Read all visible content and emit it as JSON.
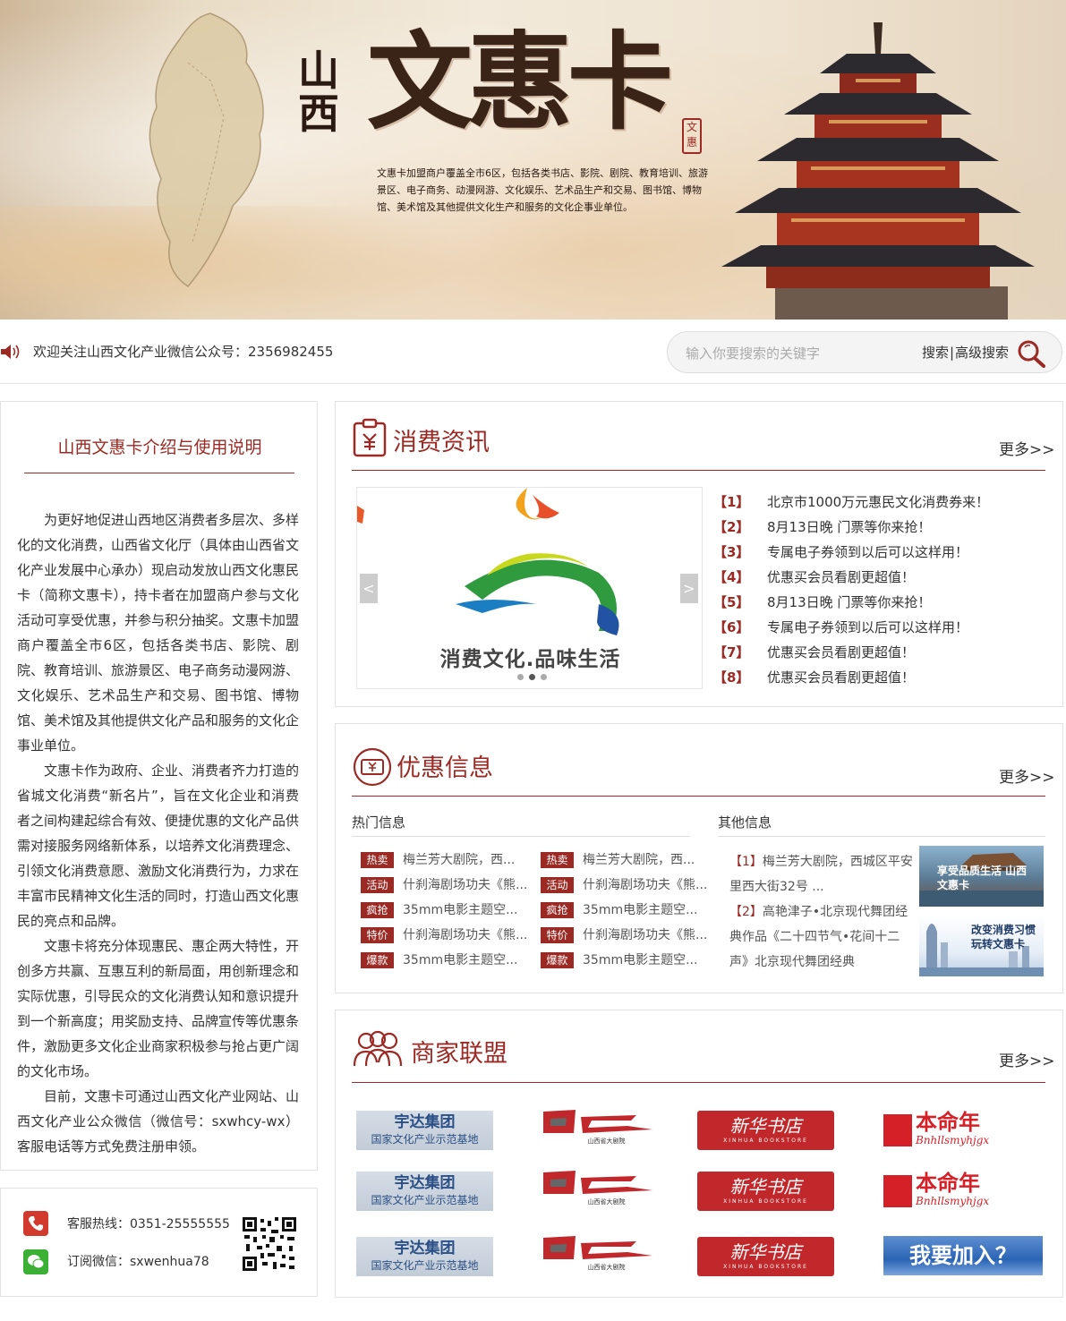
{
  "banner": {
    "logo_small": "山西",
    "logo_big": "文惠卡",
    "seal": "文惠",
    "description": "文惠卡加盟商户覆盖全市6区，包括各类书店、影院、剧院、教育培训、旅游景区、电子商务、动漫网游、文化娱乐、艺术品生产和交易、图书馆、博物馆、美术馆及其他提供文化生产和服务的文化企事业单位。"
  },
  "notice": {
    "text": "欢迎关注山西文化产业微信公众号：2356982455"
  },
  "search": {
    "placeholder": "输入你要搜索的关键字",
    "value": "",
    "search_label": "搜索",
    "separator": "|",
    "advanced_label": "高级搜索"
  },
  "intro": {
    "title": "山西文惠卡介绍与使用说明",
    "paragraphs": [
      "为更好地促进山西地区消费者多层次、多样化的文化消费，山西省文化厅（具体由山西省文化产业发展中心承办）现启动发放山西文化惠民卡（简称文惠卡），持卡者在加盟商户参与文化活动可享受优惠，并参与积分抽奖。文惠卡加盟商户覆盖全市6区，包括各类书店、影院、剧院、教育培训、旅游景区、电子商务动漫网游、文化娱乐、艺术品生产和交易、图书馆、博物馆、美术馆及其他提供文化产品和服务的文化企事业单位。",
      "文惠卡作为政府、企业、消费者齐力打造的省城文化消费“新名片”，旨在文化企业和消费者之间构建起综合有效、便捷优惠的文化产品供需对接服务网络新体系，以培养文化消费理念、引领文化消费意愿、激励文化消费行为，力求在丰富市民精神文化生活的同时，打造山西文化惠民的亮点和品牌。",
      "文惠卡将充分体现惠民、惠企两大特性，开创多方共赢、互惠互利的新局面，用创新理念和实际优惠，引导民众的文化消费认知和意识提升到一个新高度；用奖励支持、品牌宣传等优惠条件，激励更多文化企业商家积极参与抢占更广阔的文化市场。",
      "目前，文惠卡可通过山西文化产业网站、山西文化产业公众微信（微信号：sxwhcy-wx）客服电话等方式免费注册申领。"
    ]
  },
  "contact": {
    "hotline": "客服热线：0351-25555555",
    "wechat": "订阅微信：sxwenhua78"
  },
  "consumer_news": {
    "title": "消费资讯",
    "more": "更多>>",
    "slider_caption": "消费文化.品味生活",
    "prev": "<",
    "next": ">",
    "slide_count": 3,
    "active_slide": 2,
    "items": [
      {
        "num": "【1】",
        "title": "北京市1000万元惠民文化消费券来！"
      },
      {
        "num": "【2】",
        "title": "8月13日晚 门票等你来抢！"
      },
      {
        "num": "【3】",
        "title": "专属电子券领到以后可以这样用！"
      },
      {
        "num": "【4】",
        "title": "优惠买会员看剧更超值！"
      },
      {
        "num": "【5】",
        "title": "8月13日晚 门票等你来抢！"
      },
      {
        "num": "【6】",
        "title": "专属电子券领到以后可以这样用！"
      },
      {
        "num": "【7】",
        "title": "优惠买会员看剧更超值！"
      },
      {
        "num": "【8】",
        "title": "优惠买会员看剧更超值！"
      }
    ]
  },
  "promotions": {
    "title": "优惠信息",
    "more": "更多>>",
    "hot_heading": "热门信息",
    "other_heading": "其他信息",
    "hot_col1": [
      {
        "tag": "热卖",
        "text": "梅兰芳大剧院，西..."
      },
      {
        "tag": "活动",
        "text": "什刹海剧场功夫《熊..."
      },
      {
        "tag": "疯抢",
        "text": "35mm电影主题空..."
      },
      {
        "tag": "特价",
        "text": "什刹海剧场功夫《熊..."
      },
      {
        "tag": "爆款",
        "text": "35mm电影主题空..."
      }
    ],
    "hot_col2": [
      {
        "tag": "热卖",
        "text": "梅兰芳大剧院，西..."
      },
      {
        "tag": "活动",
        "text": "什刹海剧场功夫《熊..."
      },
      {
        "tag": "疯抢",
        "text": "35mm电影主题空..."
      },
      {
        "tag": "特价",
        "text": "什刹海剧场功夫《熊..."
      },
      {
        "tag": "爆款",
        "text": "35mm电影主题空..."
      }
    ],
    "other": [
      {
        "num": "【1】",
        "text": "梅兰芳大剧院，西城区平安里西大街32号 ..."
      },
      {
        "num": "【2】",
        "text": "高艳津子•北京现代舞团经典作品《二十四节气•花间十二声》北京现代舞团经典"
      }
    ],
    "thumb1_caption": "享受品质生活 山西文惠卡",
    "thumb2_caption": "改变消费习惯 玩转文惠卡"
  },
  "merchants": {
    "title": "商家联盟",
    "more": "更多>>",
    "yuda_name": "宇达集团",
    "yuda_sub": "国家文化产业示范基地",
    "theatre_name": "山西省大剧院",
    "xinhua_name": "新华书店",
    "xinhua_sub": "XINHUA BOOKSTORE",
    "bmn_name": "本命年",
    "bmn_sub": "Bnhllsmyhjgx",
    "join_label": "我要加入？"
  },
  "colors": {
    "accent": "#9b2a24",
    "phone": "#d23a2e",
    "wechat": "#3cb034"
  }
}
